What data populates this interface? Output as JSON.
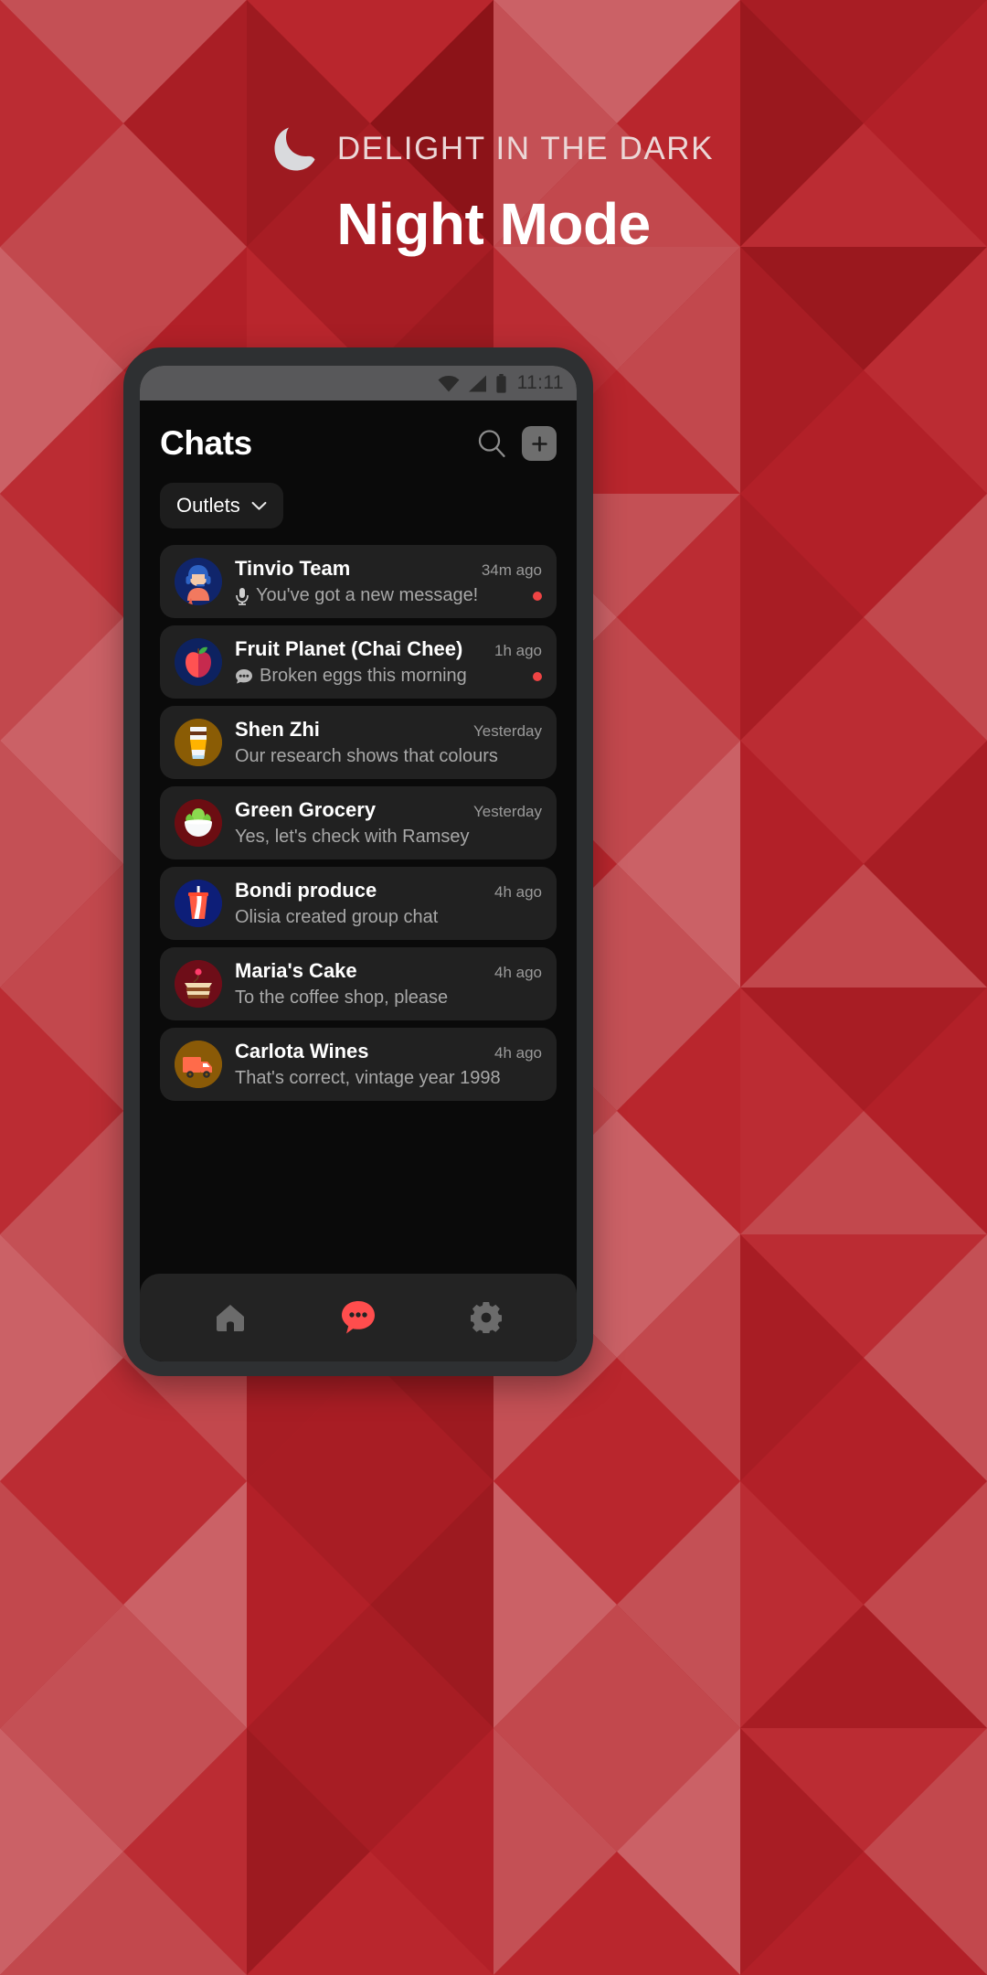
{
  "poster": {
    "eyebrow": "DELIGHT IN THE DARK",
    "eyebrow_icon": "moon-icon",
    "headline": "Night Mode",
    "background_colors": {
      "base": "#b22028",
      "light": "#c45055",
      "lighter": "#cb6166",
      "mid": "#bb2c33",
      "dark": "#9d1a20",
      "darkest": "#8c1318"
    },
    "headline_color": "#ffffff",
    "eyebrow_color": "#ecd7d7"
  },
  "phone": {
    "frame_color": "#2e3032",
    "statusbar": {
      "time": "11:11",
      "icons": [
        "wifi-icon",
        "cellular-signal-icon",
        "battery-icon"
      ],
      "background": "#58585a"
    },
    "header": {
      "title": "Chats",
      "search_icon": "search-icon",
      "add_icon": "plus-icon"
    },
    "filter": {
      "label": "Outlets",
      "chevron_icon": "chevron-down-icon"
    },
    "chats": [
      {
        "name": "Tinvio Team",
        "time": "34m ago",
        "preview": "You've got a new message!",
        "preview_icon": "microphone-icon",
        "unread": true,
        "avatar": "support-agent-avatar",
        "avatar_bg": "#10256b"
      },
      {
        "name": "Fruit Planet (Chai Chee)",
        "time": "1h ago",
        "preview": "Broken eggs this morning",
        "preview_icon": "speech-bubble-icon",
        "unread": true,
        "avatar": "apple-avatar",
        "avatar_bg": "#0d2260"
      },
      {
        "name": "Shen Zhi",
        "time": "Yesterday",
        "preview": "Our research shows that colours",
        "preview_icon": "",
        "unread": false,
        "avatar": "coffee-cup-avatar",
        "avatar_bg": "#8a5c05"
      },
      {
        "name": "Green Grocery",
        "time": "Yesterday",
        "preview": "Yes, let's check with Ramsey",
        "preview_icon": "",
        "unread": false,
        "avatar": "salad-bowl-avatar",
        "avatar_bg": "#6c0d12"
      },
      {
        "name": "Bondi produce",
        "time": "4h ago",
        "preview": "Olisia created group chat",
        "preview_icon": "",
        "unread": false,
        "avatar": "soda-cup-avatar",
        "avatar_bg": "#0d1e78"
      },
      {
        "name": "Maria's Cake",
        "time": "4h ago",
        "preview": "To the coffee shop, please",
        "preview_icon": "",
        "unread": false,
        "avatar": "cake-slice-avatar",
        "avatar_bg": "#6e0d18"
      },
      {
        "name": "Carlota Wines",
        "time": "4h ago",
        "preview": "That's correct, vintage year 1998",
        "preview_icon": "",
        "unread": false,
        "avatar": "delivery-truck-avatar",
        "avatar_bg": "#8a5a07"
      }
    ],
    "bottom_nav": [
      {
        "icon": "home-icon",
        "active": false
      },
      {
        "icon": "chat-bubble-icon",
        "active": true
      },
      {
        "icon": "gear-icon",
        "active": false
      }
    ],
    "accent_color": "#ff4d4d"
  }
}
